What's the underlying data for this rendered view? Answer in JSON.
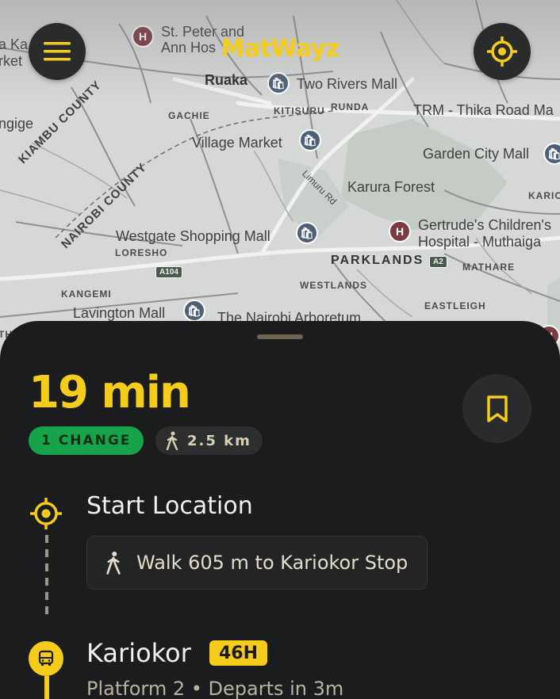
{
  "app": {
    "title": "MatWayz"
  },
  "map": {
    "places": {
      "st_peter": "St. Peter and Ann Hospital",
      "st_peter_l1": "St. Peter and",
      "st_peter_l2": "Ann Hos",
      "ruaka": "Ruaka",
      "two_rivers": "Two Rivers Mall",
      "gachie": "GACHIE",
      "kitisuru": "KITISURU",
      "runda": "RUNDA",
      "trm": "TRM - Thika Road Ma",
      "village_market": "Village Market",
      "garden_city": "Garden City Mall",
      "kiambu_county": "KIAMBU COUNTY",
      "nairobi_county": "NAIROBI COUNTY",
      "karura_forest": "Karura Forest",
      "limuru_rd": "Limuru Rd",
      "kario": "KARIO",
      "gertrudes_l1": "Gertrude's Children's",
      "gertrudes_l2": "Hospital - Muthaiga",
      "westgate": "Westgate Shopping Mall",
      "loresho": "LORESHO",
      "parklands": "PARKLANDS",
      "a2": "A2",
      "mathare": "MATHARE",
      "a104": "A104",
      "westlands": "WESTLANDS",
      "kangemi": "KANGEMI",
      "lavington": "Lavington Mall",
      "eastleigh": "EASTLEIGH",
      "arboretum": "The Nairobi Arboretum",
      "left_ka": "a Ka",
      "left_rket": "rket",
      "left_ngige": "ngige",
      "left_th": "TH"
    }
  },
  "trip": {
    "duration": "19 min",
    "changes_label": "1 CHANGE",
    "walk_distance": "2.5 km",
    "start": {
      "title": "Start Location",
      "walk_instruction": "Walk 605 m to Kariokor Stop"
    },
    "stop": {
      "name": "Kariokor",
      "route": "46H",
      "detail": "Platform 2 • Departs in 3m"
    }
  },
  "icons": {
    "menu": "menu-icon",
    "locate": "crosshair-icon",
    "bookmark": "bookmark-icon",
    "walk": "walking-person-icon",
    "bus": "bus-icon",
    "start": "target-icon"
  },
  "colors": {
    "accent": "#f6cc1b",
    "background": "#1b1c1e",
    "change_badge": "#16a34a",
    "map_base": "#d6d8d7"
  }
}
